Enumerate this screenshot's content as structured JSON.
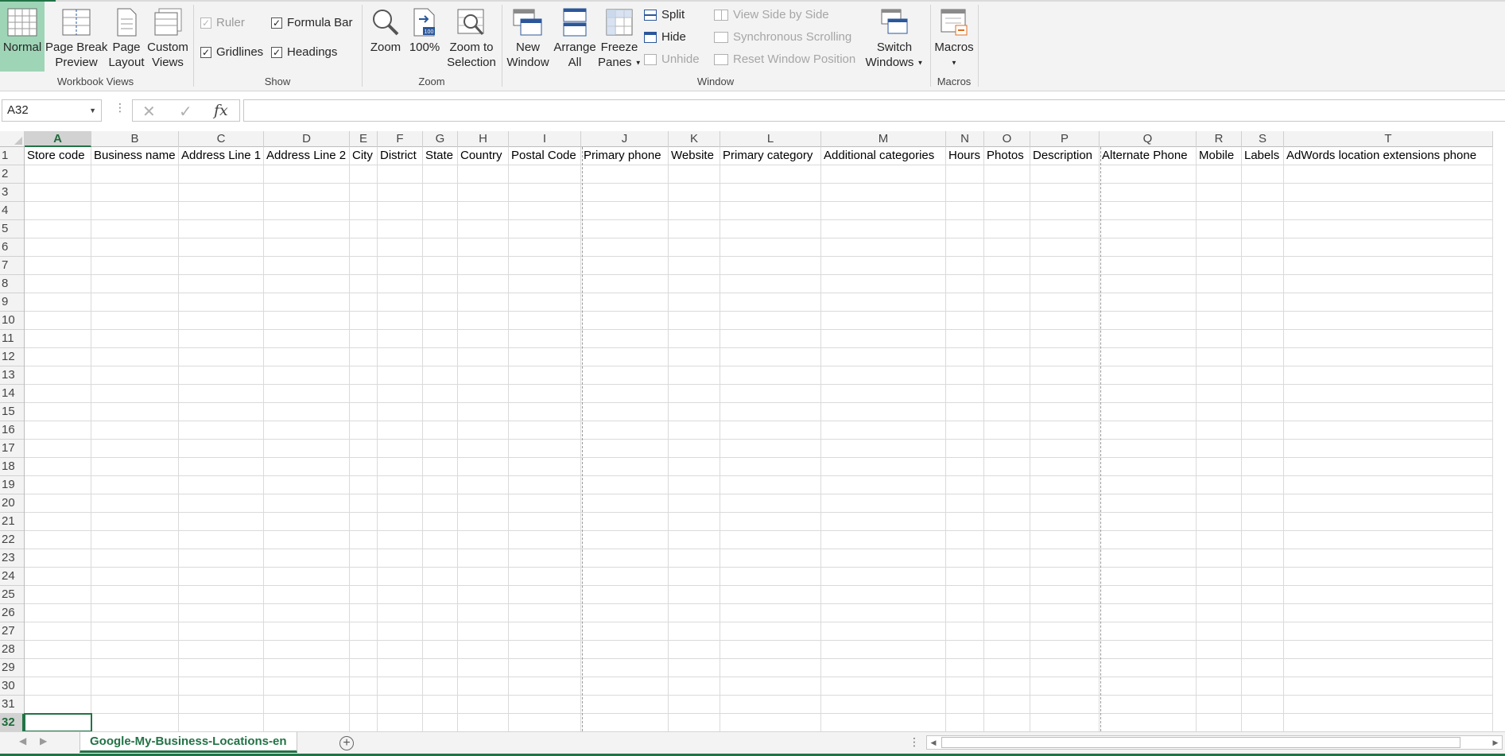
{
  "ribbon": {
    "workbook_views": {
      "group_label": "Workbook Views",
      "normal": "Normal",
      "page_break_1": "Page Break",
      "page_break_2": "Preview",
      "page_layout_1": "Page",
      "page_layout_2": "Layout",
      "custom_views_1": "Custom",
      "custom_views_2": "Views"
    },
    "show": {
      "group_label": "Show",
      "ruler": "Ruler",
      "formula_bar": "Formula Bar",
      "gridlines": "Gridlines",
      "headings": "Headings"
    },
    "zoom": {
      "group_label": "Zoom",
      "zoom": "Zoom",
      "hundred": "100%",
      "hundred_icon_text": "100",
      "zoom_sel_1": "Zoom to",
      "zoom_sel_2": "Selection"
    },
    "window": {
      "group_label": "Window",
      "new_window_1": "New",
      "new_window_2": "Window",
      "arrange_1": "Arrange",
      "arrange_2": "All",
      "freeze_1": "Freeze",
      "freeze_2": "Panes",
      "split": "Split",
      "hide": "Hide",
      "unhide": "Unhide",
      "side_by_side": "View Side by Side",
      "sync_scroll": "Synchronous Scrolling",
      "reset_pos": "Reset Window Position",
      "switch_1": "Switch",
      "switch_2": "Windows"
    },
    "macros": {
      "group_label": "Macros",
      "macros": "Macros"
    }
  },
  "formula_bar": {
    "name_box": "A32",
    "cancel_glyph": "✕",
    "enter_glyph": "✓",
    "fx_glyph": "fx",
    "value": ""
  },
  "grid": {
    "columns": [
      "A",
      "B",
      "C",
      "D",
      "E",
      "F",
      "G",
      "H",
      "I",
      "J",
      "K",
      "L",
      "M",
      "N",
      "O",
      "P",
      "Q",
      "R",
      "S",
      "T"
    ],
    "header_row": [
      "Store code",
      "Business name",
      "Address Line 1",
      "Address Line 2",
      "City",
      "District",
      "State",
      "Country",
      "Postal Code",
      "Primary phone",
      "Website",
      "Primary category",
      "Additional categories",
      "Hours",
      "Photos",
      "Description",
      "Alternate Phone",
      "Mobile",
      "Labels",
      "AdWords location extensions phone"
    ],
    "row_count": 32,
    "active_cell": "A32",
    "active_column": "A",
    "active_row": 32
  },
  "sheet_tabs": {
    "active": "Google-My-Business-Locations-en",
    "add_glyph": "+"
  },
  "colors": {
    "accent": "#217346",
    "ribbon_bg": "#f3f3f3",
    "active_button_bg": "#9fd5b7"
  }
}
